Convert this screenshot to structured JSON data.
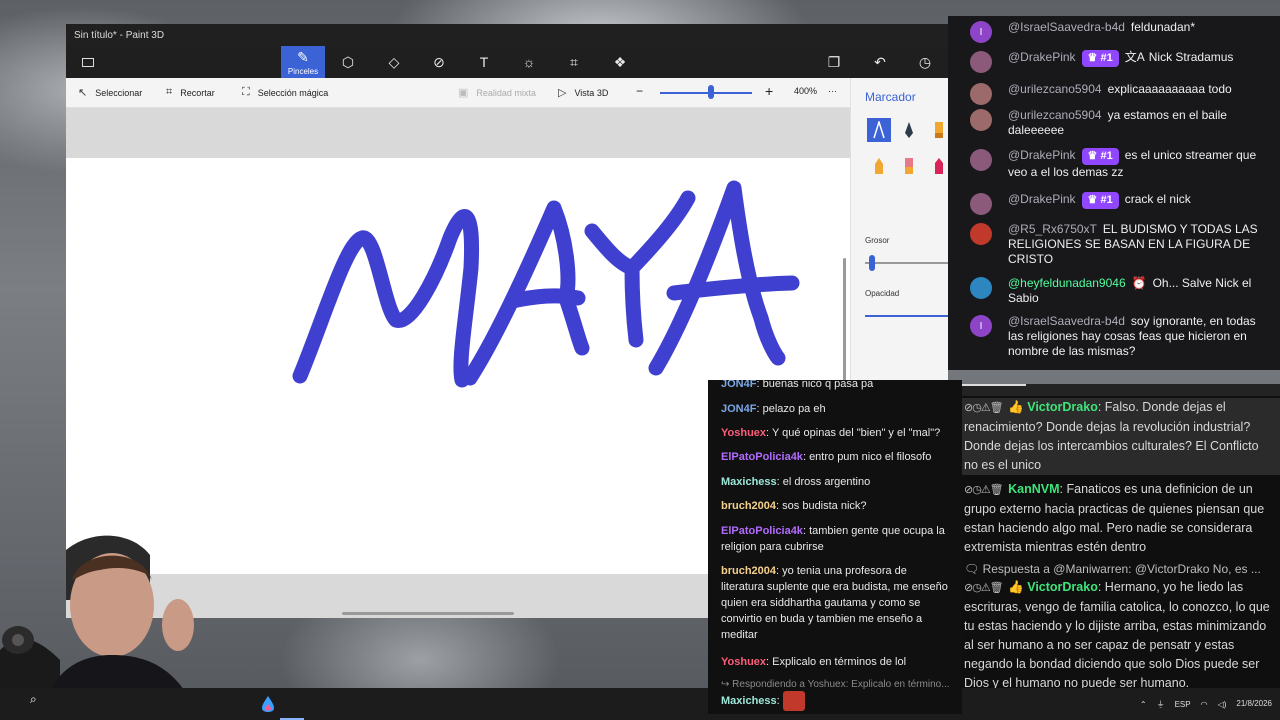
{
  "paint": {
    "title": "Sin título* - Paint 3D",
    "ribbon": {
      "active_label": "Pinceles"
    },
    "subtoolbar": {
      "select": "Seleccionar",
      "crop": "Recortar",
      "magic_select": "Selección mágica",
      "mixed_reality": "Realidad mixta",
      "view3d": "Vista 3D",
      "zoom_minus": "−",
      "zoom_plus": "+",
      "zoom_level": "400%",
      "more": "···",
      "zoom_fraction": 0.55
    },
    "panel": {
      "title": "Marcador",
      "thickness_label": "Grosor",
      "opacity_label": "Opacidad"
    },
    "drawing_word": "MAYA"
  },
  "chat_top": [
    {
      "user": "@IsraelSaavedra-b4d",
      "text": "feldunadan*",
      "avatar_color": "#8e44c7",
      "avatar_letter": "I"
    },
    {
      "user": "@DrakePink",
      "badge": "#1",
      "text": "Nick Stradamus",
      "avatar_color": "#8b5a7b"
    },
    {
      "user": "@urilezcano5904",
      "text": "explicaaaaaaaaaa todo",
      "avatar_color": "#9c6a6a"
    },
    {
      "user": "@urilezcano5904",
      "text": "ya estamos en el baile daleeeeee",
      "avatar_color": "#9c6a6a"
    },
    {
      "user": "@DrakePink",
      "badge": "#1",
      "text": "es el unico streamer que veo a el los demas zz",
      "avatar_color": "#8b5a7b"
    },
    {
      "user": "@DrakePink",
      "badge": "#1",
      "text": "crack el nick",
      "avatar_color": "#8b5a7b"
    },
    {
      "user": "@R5_Rx6750xT",
      "text": "EL BUDISMO Y TODAS LAS RELIGIONES SE BASAN EN LA FIGURA DE CRISTO",
      "avatar_color": "#c0392b"
    },
    {
      "user": "@heyfeldunadan9046",
      "text": "Oh... Salve Nick el Sabio",
      "avatar_color": "#2e86c1"
    },
    {
      "user": "@IsraelSaavedra-b4d",
      "text": "soy ignorante, en todas las religiones hay cosas feas que hicieron en nombre de las mismas?",
      "avatar_color": "#8e44c7",
      "avatar_letter": "I"
    }
  ],
  "chat_mid": [
    {
      "user": "JON4F",
      "color": "#7aa7e6",
      "text": "buenas nico q pasa pa"
    },
    {
      "user": "JON4F",
      "color": "#7aa7e6",
      "text": "pelazo pa eh"
    },
    {
      "user": "Yoshuex",
      "color": "#ff5d7a",
      "text": "Y qué opinas del \"bien\" y el \"mal\"?"
    },
    {
      "user": "ElPatoPolicia4k",
      "color": "#b36bff",
      "text": "entro pum nico el filosofo"
    },
    {
      "user": "Maxichess",
      "color": "#9ce7d8",
      "text": "el dross argentino"
    },
    {
      "user": "bruch2004",
      "color": "#f5d08a",
      "text": "sos budista nick?"
    },
    {
      "user": "ElPatoPolicia4k",
      "color": "#b36bff",
      "text": "tambien gente que ocupa la religion para cubrirse"
    },
    {
      "user": "bruch2004",
      "color": "#f5d08a",
      "text": "yo tenia una profesora de literatura suplente que era budista, me enseño quien era siddhartha gautama y como se convirtio en buda y tambien me enseño a meditar"
    },
    {
      "user": "Yoshuex",
      "color": "#ff5d7a",
      "text": "Explicalo en términos de lol"
    },
    {
      "reply": "↪ Respondiendo a Yoshuex: Explicalo en término..."
    },
    {
      "user": "Maxichess",
      "color": "#9ce7d8",
      "text": ""
    }
  ],
  "chat_right": [
    {
      "user": "VictorDrako",
      "text": "Falso. Donde dejas el renacimiento? Donde dejas la revolución industrial? Donde dejas los intercambios culturales? El Conflicto no es el unico"
    },
    {
      "user": "KanNVM",
      "text": "Fanaticos es una definicion de un grupo externo hacia practicas de quienes piensan que estan haciendo algo mal. Pero nadie se considerara extremista mientras estén dentro"
    },
    {
      "reply": "Respuesta a @Maniwarren: @VictorDrako No, es ..."
    },
    {
      "user": "VictorDrako",
      "text": "Hermano, yo he liedo las escrituras, vengo de familia catolica, lo conozco, lo que tu estas haciendo y lo dijiste arriba, estas minimizando al ser humano a no ser capaz de pensatr y estas negando la bondad diciendo que solo Dios puede ser Dios y el humano no puede ser humano."
    }
  ],
  "taskbar": {
    "lang": "ESP",
    "time": "",
    "date": "21/8/2026"
  },
  "colors": {
    "accent": "#3b63d6",
    "stroke": "#4040d0",
    "chat_bg": "#18181b",
    "badge": "#9147ff"
  }
}
